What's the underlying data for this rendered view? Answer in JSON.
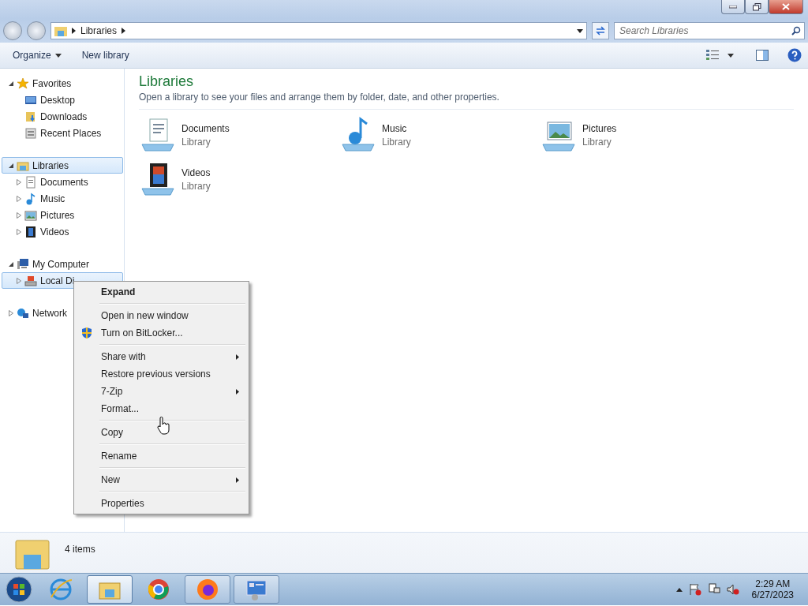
{
  "address": {
    "path": [
      "Libraries"
    ]
  },
  "search": {
    "placeholder": "Search Libraries"
  },
  "toolbar": {
    "buttons": [
      {
        "label": "Organize",
        "dropdown": true
      },
      {
        "label": "New library",
        "dropdown": false
      }
    ]
  },
  "nav": [
    {
      "label": "Favorites",
      "expanded": true,
      "selected": false,
      "children": [
        {
          "label": "Desktop",
          "selected": false
        },
        {
          "label": "Downloads",
          "selected": false
        },
        {
          "label": "Recent Places",
          "selected": false
        }
      ]
    },
    {
      "label": "Libraries",
      "expanded": true,
      "selected": true,
      "children": [
        {
          "label": "Documents",
          "selected": false,
          "expanded": false
        },
        {
          "label": "Music",
          "selected": false,
          "expanded": false
        },
        {
          "label": "Pictures",
          "selected": false,
          "expanded": false
        },
        {
          "label": "Videos",
          "selected": false,
          "expanded": false
        }
      ]
    },
    {
      "label": "My Computer",
      "expanded": true,
      "selected": false,
      "children": [
        {
          "label": "Local Di",
          "selected": true,
          "expanded": false
        }
      ]
    },
    {
      "label": "Network",
      "expanded": false,
      "selected": false
    }
  ],
  "content": {
    "title": "Libraries",
    "subtitle": "Open a library to see your files and arrange them by folder, date, and other properties.",
    "libraries": [
      {
        "name": "Documents",
        "type": "Library"
      },
      {
        "name": "Music",
        "type": "Library"
      },
      {
        "name": "Pictures",
        "type": "Library"
      },
      {
        "name": "Videos",
        "type": "Library"
      }
    ]
  },
  "details": {
    "count": "4 items"
  },
  "context_menu": [
    {
      "kind": "item",
      "label": "Expand",
      "default": true,
      "submenu": false
    },
    {
      "kind": "separator"
    },
    {
      "kind": "item",
      "label": "Open in new window",
      "default": false,
      "submenu": false
    },
    {
      "kind": "item",
      "label": "Turn on BitLocker...",
      "default": false,
      "submenu": false
    },
    {
      "kind": "separator"
    },
    {
      "kind": "item",
      "label": "Share with",
      "default": false,
      "submenu": true
    },
    {
      "kind": "item",
      "label": "Restore previous versions",
      "default": false,
      "submenu": false
    },
    {
      "kind": "item",
      "label": "7-Zip",
      "default": false,
      "submenu": true
    },
    {
      "kind": "item",
      "label": "Format...",
      "default": false,
      "submenu": false
    },
    {
      "kind": "separator"
    },
    {
      "kind": "item",
      "label": "Copy",
      "default": false,
      "submenu": false
    },
    {
      "kind": "separator"
    },
    {
      "kind": "item",
      "label": "Rename",
      "default": false,
      "submenu": false
    },
    {
      "kind": "separator"
    },
    {
      "kind": "item",
      "label": "New",
      "default": false,
      "submenu": true
    },
    {
      "kind": "separator"
    },
    {
      "kind": "item",
      "label": "Properties",
      "default": false,
      "submenu": false
    }
  ],
  "taskbar": {
    "apps": [
      {
        "running": false,
        "selected": false
      },
      {
        "running": true,
        "selected": true
      },
      {
        "running": false,
        "selected": false
      },
      {
        "running": true,
        "selected": false
      },
      {
        "running": true,
        "selected": false
      }
    ],
    "time": "2:29 AM",
    "date": "6/27/2023"
  }
}
